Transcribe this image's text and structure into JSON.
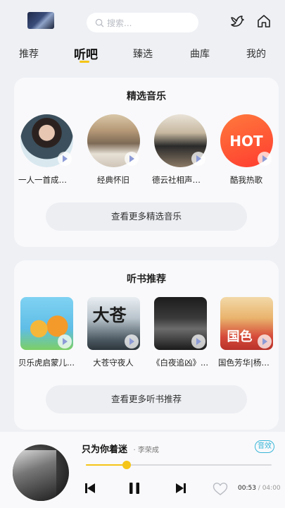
{
  "header": {
    "search_placeholder": "搜索..."
  },
  "tabs": [
    {
      "label": "推荐"
    },
    {
      "label": "听吧",
      "active": true
    },
    {
      "label": "臻选"
    },
    {
      "label": "曲库"
    },
    {
      "label": "我的"
    }
  ],
  "music_section": {
    "title": "精选音乐",
    "items": [
      {
        "label": "一人一首成名曲"
      },
      {
        "label": "经典怀旧"
      },
      {
        "label": "德云社相声全集"
      },
      {
        "label": "酷我热歌",
        "cover_text": "HOT"
      }
    ],
    "more_label": "查看更多精选音乐"
  },
  "book_section": {
    "title": "听书推荐",
    "items": [
      {
        "label": "贝乐虎启蒙儿..."
      },
      {
        "label": "大苍守夜人",
        "cover_text": "大苍"
      },
      {
        "label": "《白夜追凶》..."
      },
      {
        "label": "国色芳华|杨紫...",
        "cover_text": "国色"
      }
    ],
    "more_label": "查看更多听书推荐"
  },
  "player": {
    "song": "只为你着迷",
    "artist": "李荣成",
    "lyric_label": "音效",
    "current_time": "00:53",
    "total_time": "04:00",
    "progress": 0.22,
    "accent": "#f5c518"
  }
}
